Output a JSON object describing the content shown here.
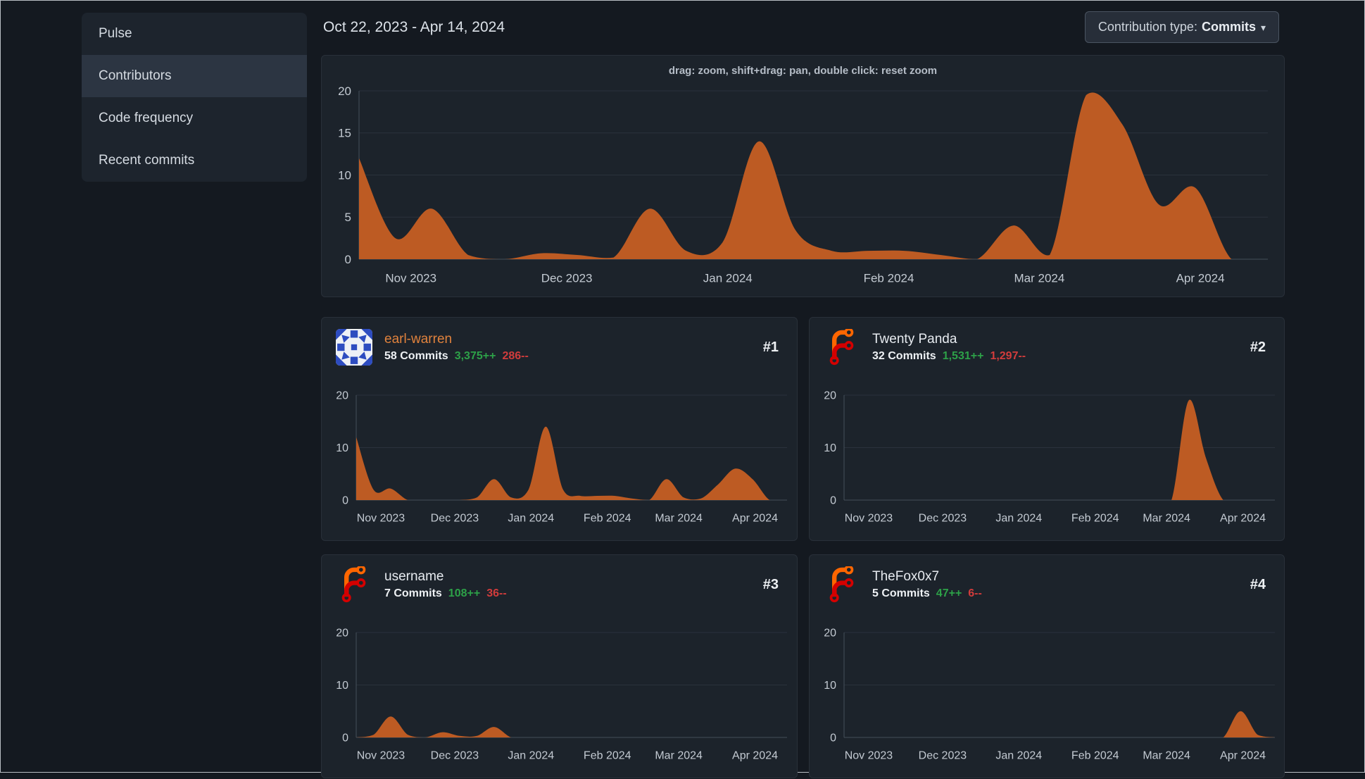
{
  "sidebar": {
    "items": [
      {
        "label": "Pulse",
        "active": false
      },
      {
        "label": "Contributors",
        "active": true
      },
      {
        "label": "Code frequency",
        "active": false
      },
      {
        "label": "Recent commits",
        "active": false
      }
    ]
  },
  "header": {
    "date_range": "Oct 22, 2023 - Apr 14, 2024",
    "contribution_type_label": "Contribution type:",
    "contribution_type_value": "Commits",
    "caret": "▾"
  },
  "main_chart_hint": "drag: zoom, shift+drag: pan, double click: reset zoom",
  "contributors": [
    {
      "rank": "#1",
      "name": "earl-warren",
      "commits": "58 Commits",
      "additions": "3,375++",
      "deletions": "286--",
      "avatar": "identicon",
      "linked": true
    },
    {
      "rank": "#2",
      "name": "Twenty Panda",
      "commits": "32 Commits",
      "additions": "1,531++",
      "deletions": "1,297--",
      "avatar": "forgejo-logo",
      "linked": false
    },
    {
      "rank": "#3",
      "name": "username",
      "commits": "7 Commits",
      "additions": "108++",
      "deletions": "36--",
      "avatar": "forgejo-logo",
      "linked": false
    },
    {
      "rank": "#4",
      "name": "TheFox0x7",
      "commits": "5 Commits",
      "additions": "47++",
      "deletions": "6--",
      "avatar": "forgejo-logo",
      "linked": false
    }
  ],
  "chart_data": [
    {
      "id": "overall-commits",
      "type": "area",
      "title": "Commit activity, all contributors (weekly)",
      "x_start": "Oct 22, 2023",
      "x_end": "Apr 14, 2024",
      "x_labels": [
        "Nov 2023",
        "Dec 2023",
        "Jan 2024",
        "Feb 2024",
        "Mar 2024",
        "Apr 2024"
      ],
      "ylim": [
        0,
        20
      ],
      "yticks": [
        0,
        5,
        10,
        15,
        20
      ],
      "values": [
        12,
        2.5,
        6,
        0.5,
        0,
        0.7,
        0.5,
        0.2,
        6,
        1,
        2,
        14,
        3.5,
        1,
        1,
        1,
        0.5,
        0,
        4,
        0.5,
        19.5,
        16,
        6.5,
        8.5,
        0,
        0
      ]
    },
    {
      "id": "earl-warren",
      "type": "area",
      "title": "earl-warren weekly commits",
      "x_labels": [
        "Nov 2023",
        "Dec 2023",
        "Jan 2024",
        "Feb 2024",
        "Mar 2024",
        "Apr 2024"
      ],
      "ylim": [
        0,
        20
      ],
      "yticks": [
        0,
        10,
        20
      ],
      "values": [
        12,
        2,
        2.2,
        0,
        0,
        0,
        0,
        0.5,
        4,
        0.5,
        2,
        14,
        2,
        0.8,
        0.8,
        0.8,
        0.3,
        0,
        4,
        0.5,
        0.3,
        3,
        6,
        4,
        0,
        0
      ]
    },
    {
      "id": "twenty-panda",
      "type": "area",
      "title": "Twenty Panda weekly commits",
      "x_labels": [
        "Nov 2023",
        "Dec 2023",
        "Jan 2024",
        "Feb 2024",
        "Mar 2024",
        "Apr 2024"
      ],
      "ylim": [
        0,
        20
      ],
      "yticks": [
        0,
        10,
        20
      ],
      "values": [
        0,
        0,
        0,
        0,
        0,
        0,
        0,
        0,
        0,
        0,
        0,
        0,
        0,
        0,
        0,
        0,
        0,
        0,
        0,
        0,
        19,
        8,
        0,
        0,
        0,
        0
      ]
    },
    {
      "id": "username",
      "type": "area",
      "title": "username weekly commits",
      "x_labels": [
        "Nov 2023",
        "Dec 2023",
        "Jan 2024",
        "Feb 2024",
        "Mar 2024",
        "Apr 2024"
      ],
      "ylim": [
        0,
        20
      ],
      "yticks": [
        0,
        10,
        20
      ],
      "values": [
        0,
        0.5,
        4,
        0.5,
        0,
        1,
        0.3,
        0.3,
        2,
        0,
        0,
        0,
        0,
        0,
        0,
        0,
        0,
        0,
        0,
        0,
        0,
        0,
        0,
        0,
        0,
        0
      ]
    },
    {
      "id": "thefox0x7",
      "type": "area",
      "title": "TheFox0x7 weekly commits",
      "x_labels": [
        "Nov 2023",
        "Dec 2023",
        "Jan 2024",
        "Feb 2024",
        "Mar 2024",
        "Apr 2024"
      ],
      "ylim": [
        0,
        20
      ],
      "yticks": [
        0,
        10,
        20
      ],
      "values": [
        0,
        0,
        0,
        0,
        0,
        0,
        0,
        0,
        0,
        0,
        0,
        0,
        0,
        0,
        0,
        0,
        0,
        0,
        0,
        0,
        0,
        0,
        0,
        5,
        0.5,
        0
      ]
    }
  ],
  "colors": {
    "area": "#bd5b23",
    "link_orange": "#e0823d",
    "additions_green": "#2da148",
    "deletions_red": "#d13c3c",
    "identicon_blue": "#2d4cc0",
    "identicon_bg": "#eef1f6",
    "forgejo_orange": "#ff6600",
    "forgejo_red": "#d40000",
    "panel_bg": "#1c232b",
    "page_bg": "#141920"
  }
}
